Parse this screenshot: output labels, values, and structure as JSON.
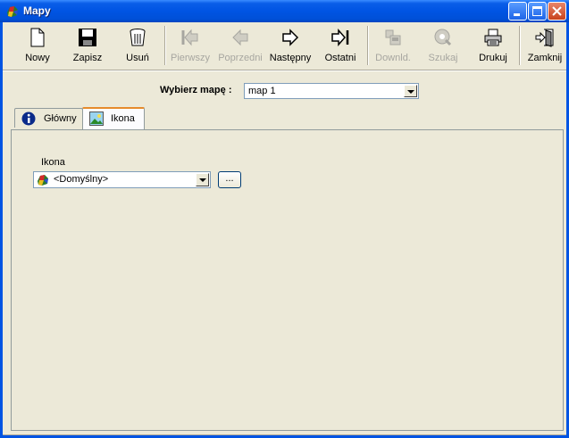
{
  "window": {
    "title": "Mapy"
  },
  "toolbar": {
    "buttons": [
      {
        "label": "Nowy",
        "icon": "new-document-icon",
        "enabled": true
      },
      {
        "label": "Zapisz",
        "icon": "floppy-disk-icon",
        "enabled": true
      },
      {
        "label": "Usuń",
        "icon": "trash-can-icon",
        "enabled": true
      },
      {
        "label": "Pierwszy",
        "icon": "first-arrow-icon",
        "enabled": false
      },
      {
        "label": "Poprzedni",
        "icon": "previous-arrow-icon",
        "enabled": false
      },
      {
        "label": "Następny",
        "icon": "next-arrow-icon",
        "enabled": true
      },
      {
        "label": "Ostatni",
        "icon": "last-arrow-icon",
        "enabled": true
      },
      {
        "label": "Downld.",
        "icon": "download-icon",
        "enabled": false
      },
      {
        "label": "Szukaj",
        "icon": "search-icon",
        "enabled": false
      },
      {
        "label": "Drukuj",
        "icon": "printer-icon",
        "enabled": true
      },
      {
        "label": "Zamknij",
        "icon": "exit-door-icon",
        "enabled": true
      }
    ]
  },
  "map_select": {
    "label": "Wybierz mapę :",
    "value": "map 1"
  },
  "tabs": [
    {
      "label": "Główny",
      "icon": "info-icon",
      "active": false
    },
    {
      "label": "Ikona",
      "icon": "image-icon",
      "active": true
    }
  ],
  "icon_field": {
    "label": "Ikona",
    "value": "<Domyślny>",
    "browse_label": "..."
  },
  "colors": {
    "titlebar": "#0054e3",
    "tab_highlight": "#e68b2c",
    "window_bg": "#ece9d8"
  }
}
